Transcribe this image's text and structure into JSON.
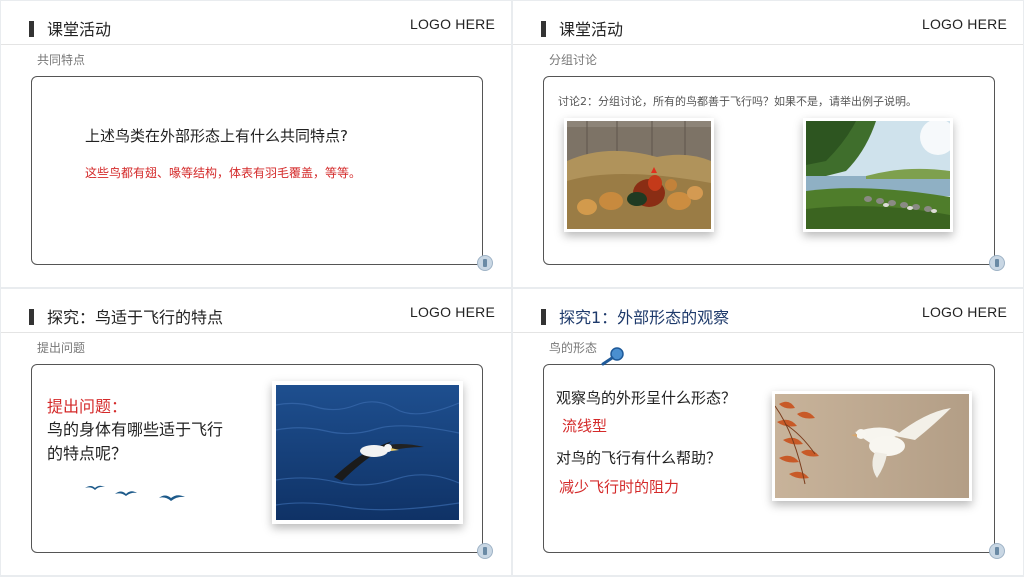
{
  "logo_text": "LOGO HERE",
  "slides": [
    {
      "title": "课堂活动",
      "subtitle": "共同特点",
      "question": "上述鸟类在外部形态上有什么共同特点?",
      "answer": "这些鸟都有翅、喙等结构，体表有羽毛覆盖，等等。"
    },
    {
      "title": "课堂活动",
      "subtitle": "分组讨论",
      "prompt": "讨论2：分组讨论，所有的鸟都善于飞行吗？如果不是，请举出例子说明。",
      "images": [
        "hens-photo",
        "geese-photo"
      ]
    },
    {
      "title": "探究：鸟适于飞行的特点",
      "subtitle": "提出问题",
      "question_label": "提出问题：",
      "question_line1": "鸟的身体有哪些适于飞行",
      "question_line2": "的特点呢？",
      "images": [
        "albatross-photo"
      ]
    },
    {
      "title": "探究1：外部形态的观察",
      "subtitle": "鸟的形态",
      "question1": "观察鸟的外形呈什么形态？",
      "answer1": "流线型",
      "question2": "对鸟的飞行有什么帮助？",
      "answer2": "减少飞行时的阻力",
      "images": [
        "dove-photo"
      ]
    }
  ],
  "colors": {
    "accent_red": "#d42a2a",
    "title_blue": "#1e3a6b",
    "frame_border": "#555555"
  }
}
